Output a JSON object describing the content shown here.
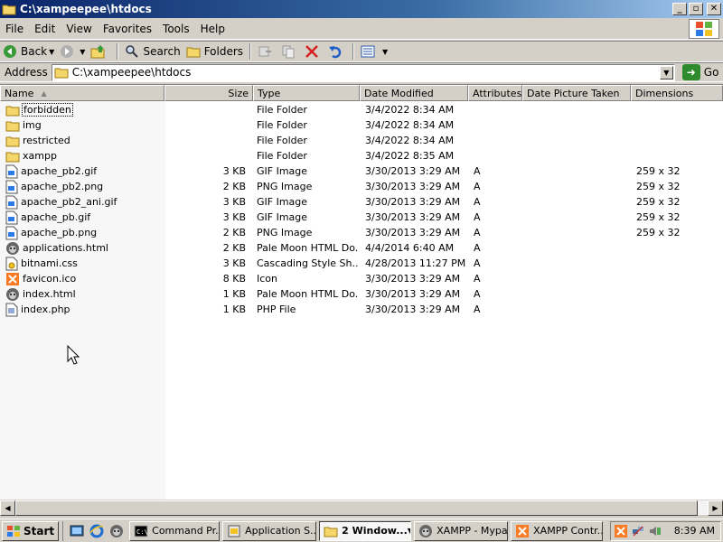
{
  "window": {
    "title": "C:\\xampeepee\\htdocs"
  },
  "menu": [
    "File",
    "Edit",
    "View",
    "Favorites",
    "Tools",
    "Help"
  ],
  "toolbar": {
    "back": "Back",
    "search": "Search",
    "folders": "Folders"
  },
  "address": {
    "label": "Address",
    "path": "C:\\xampeepee\\htdocs",
    "go": "Go"
  },
  "columns": [
    "Name",
    "Size",
    "Type",
    "Date Modified",
    "Attributes",
    "Date Picture Taken",
    "Dimensions"
  ],
  "files": [
    {
      "name": "forbidden",
      "size": "",
      "type": "File Folder",
      "date": "3/4/2022 8:34 AM",
      "attr": "",
      "dims": "",
      "icon": "folder-icon"
    },
    {
      "name": "img",
      "size": "",
      "type": "File Folder",
      "date": "3/4/2022 8:34 AM",
      "attr": "",
      "dims": "",
      "icon": "folder-icon"
    },
    {
      "name": "restricted",
      "size": "",
      "type": "File Folder",
      "date": "3/4/2022 8:34 AM",
      "attr": "",
      "dims": "",
      "icon": "folder-icon"
    },
    {
      "name": "xampp",
      "size": "",
      "type": "File Folder",
      "date": "3/4/2022 8:35 AM",
      "attr": "",
      "dims": "",
      "icon": "folder-icon"
    },
    {
      "name": "apache_pb2.gif",
      "size": "3 KB",
      "type": "GIF Image",
      "date": "3/30/2013 3:29 AM",
      "attr": "A",
      "dims": "259 x 32",
      "icon": "image-file-icon"
    },
    {
      "name": "apache_pb2.png",
      "size": "2 KB",
      "type": "PNG Image",
      "date": "3/30/2013 3:29 AM",
      "attr": "A",
      "dims": "259 x 32",
      "icon": "image-file-icon"
    },
    {
      "name": "apache_pb2_ani.gif",
      "size": "3 KB",
      "type": "GIF Image",
      "date": "3/30/2013 3:29 AM",
      "attr": "A",
      "dims": "259 x 32",
      "icon": "image-file-icon"
    },
    {
      "name": "apache_pb.gif",
      "size": "3 KB",
      "type": "GIF Image",
      "date": "3/30/2013 3:29 AM",
      "attr": "A",
      "dims": "259 x 32",
      "icon": "image-file-icon"
    },
    {
      "name": "apache_pb.png",
      "size": "2 KB",
      "type": "PNG Image",
      "date": "3/30/2013 3:29 AM",
      "attr": "A",
      "dims": "259 x 32",
      "icon": "image-file-icon"
    },
    {
      "name": "applications.html",
      "size": "2 KB",
      "type": "Pale Moon HTML Do...",
      "date": "4/4/2014 6:40 AM",
      "attr": "A",
      "dims": "",
      "icon": "pale-moon-icon"
    },
    {
      "name": "bitnami.css",
      "size": "3 KB",
      "type": "Cascading Style Sh...",
      "date": "4/28/2013 11:27 PM",
      "attr": "A",
      "dims": "",
      "icon": "css-file-icon"
    },
    {
      "name": "favicon.ico",
      "size": "8 KB",
      "type": "Icon",
      "date": "3/30/2013 3:29 AM",
      "attr": "A",
      "dims": "",
      "icon": "xampp-icon"
    },
    {
      "name": "index.html",
      "size": "1 KB",
      "type": "Pale Moon HTML Do...",
      "date": "3/30/2013 3:29 AM",
      "attr": "A",
      "dims": "",
      "icon": "pale-moon-icon"
    },
    {
      "name": "index.php",
      "size": "1 KB",
      "type": "PHP File",
      "date": "3/30/2013 3:29 AM",
      "attr": "A",
      "dims": "",
      "icon": "text-file-icon"
    }
  ],
  "taskbar": {
    "start": "Start",
    "tasks": [
      {
        "label": "Command Pr...",
        "icon": "cmd-icon",
        "active": false
      },
      {
        "label": "Application S...",
        "icon": "app-icon",
        "active": false
      },
      {
        "label": "2 Window...",
        "icon": "folder-icon",
        "active": true
      },
      {
        "label": "XAMPP - Mypal",
        "icon": "pale-moon-icon",
        "active": false
      },
      {
        "label": "XAMPP Contr...",
        "icon": "xampp-icon",
        "active": false
      }
    ],
    "clock": "8:39 AM"
  }
}
